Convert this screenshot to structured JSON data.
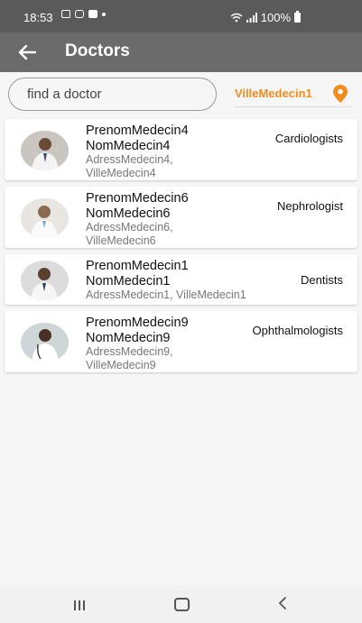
{
  "status": {
    "time": "18:53",
    "battery": "100%"
  },
  "appbar": {
    "title": "Doctors"
  },
  "search": {
    "placeholder": "find a doctor"
  },
  "location": {
    "city": "VilleMedecin1"
  },
  "doctors": [
    {
      "first": "PrenomMedecin4",
      "last": "NomMedecin4",
      "address": "AdressMedecin4,\nVilleMedecin4",
      "specialty": "Cardiologists"
    },
    {
      "first": "PrenomMedecin6",
      "last": "NomMedecin6",
      "address": "AdressMedecin6,\nVilleMedecin6",
      "specialty": "Nephrologist"
    },
    {
      "first": "PrenomMedecin1",
      "last": "NomMedecin1",
      "address": "AdressMedecin1, VilleMedecin1",
      "specialty": "Dentists"
    },
    {
      "first": "PrenomMedecin9",
      "last": "NomMedecin9",
      "address": "AdressMedecin9,\nVilleMedecin9",
      "specialty": "Ophthalmologists"
    }
  ],
  "colors": {
    "accent": "#f28c1e",
    "appbar": "#6b6b6b",
    "statusbar": "#5a5a5a"
  }
}
